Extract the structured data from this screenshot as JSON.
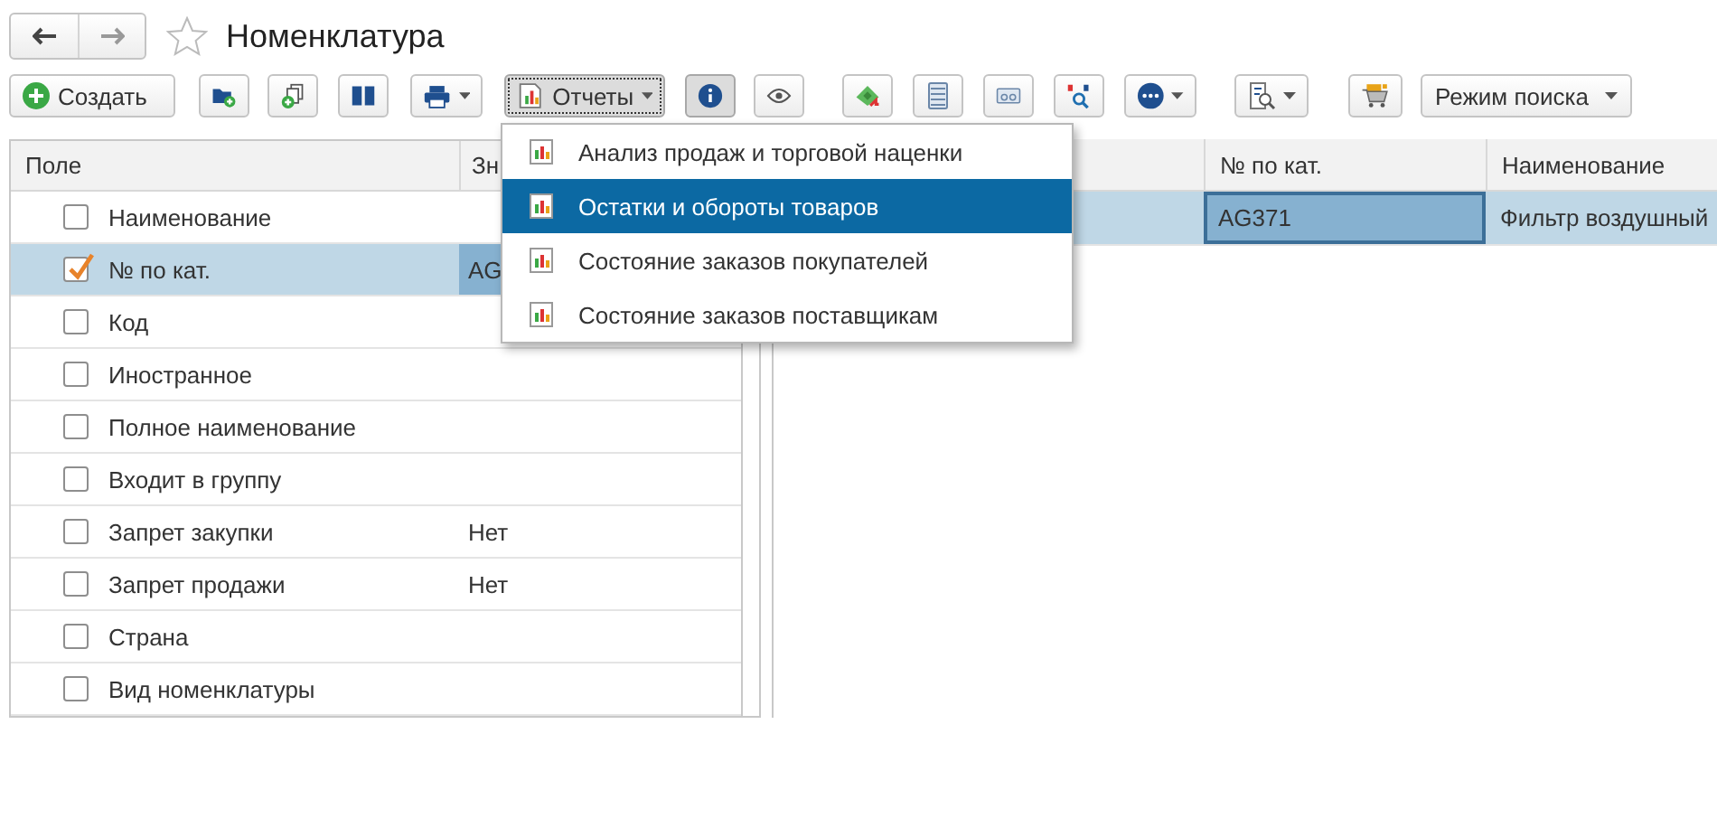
{
  "header": {
    "title": "Номенклатура",
    "favorite": false
  },
  "toolbar": {
    "create": "Создать",
    "reports": "Отчеты",
    "reports_expanded": true,
    "info_pressed": true,
    "search_mode": "Режим поиска"
  },
  "fields_panel": {
    "columns": [
      "Поле",
      "Зн"
    ],
    "rows": [
      {
        "name": "Наименование",
        "checked": false,
        "selected": false
      },
      {
        "name": "№ по кат.",
        "value": "AG",
        "checked": true,
        "selected": true
      },
      {
        "name": "Код",
        "checked": false,
        "selected": false
      },
      {
        "name": "Иностранное",
        "checked": false,
        "selected": false
      },
      {
        "name": "Полное наименование",
        "checked": false,
        "selected": false
      },
      {
        "name": "Входит в группу",
        "checked": false,
        "selected": false
      },
      {
        "name": "Запрет закупки",
        "value": "Нет",
        "checked": false,
        "selected": false
      },
      {
        "name": "Запрет продажи",
        "value": "Нет",
        "checked": false,
        "selected": false
      },
      {
        "name": "Страна",
        "checked": false,
        "selected": false
      },
      {
        "name": "Вид номенклатуры",
        "checked": false,
        "selected": false
      }
    ]
  },
  "list_panel": {
    "columns": [
      "№ по кат.",
      "Наименование"
    ],
    "rows": [
      {
        "cells": [
          "AG371",
          "Фильтр воздушный"
        ],
        "selected": true
      }
    ]
  },
  "reports_menu": {
    "items": [
      {
        "label": "Анализ продаж и торговой наценки",
        "selected": false
      },
      {
        "label": "Остатки и обороты товаров",
        "selected": true
      },
      {
        "label": "Состояние заказов покупателей",
        "selected": false
      },
      {
        "label": "Состояние заказов поставщикам",
        "selected": false
      }
    ]
  }
}
